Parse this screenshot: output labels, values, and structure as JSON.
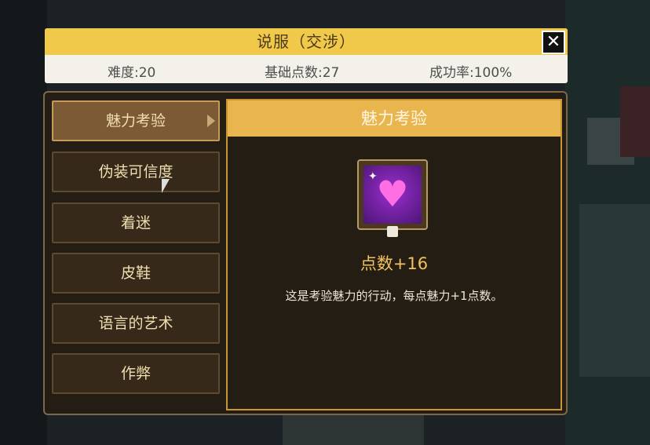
{
  "header": {
    "title": "说服（交涉）",
    "close_label": "✕",
    "difficulty": "难度:20",
    "base_points": "基础点数:27",
    "success_rate": "成功率:100%"
  },
  "tabs": [
    {
      "label": "魅力考验",
      "active": true
    },
    {
      "label": "伪装可信度",
      "active": false
    },
    {
      "label": "着迷",
      "active": false
    },
    {
      "label": "皮鞋",
      "active": false
    },
    {
      "label": "语言的艺术",
      "active": false
    },
    {
      "label": "作弊",
      "active": false
    }
  ],
  "detail": {
    "title": "魅力考验",
    "icon": "heart-icon",
    "points": "点数+16",
    "description": "这是考验魅力的行动，每点魅力+1点数。"
  },
  "colors": {
    "header_bar": "#f1c94a",
    "panel_bg": "#241d14",
    "active_tab": "#7c5a35",
    "accent": "#f2c35a"
  }
}
